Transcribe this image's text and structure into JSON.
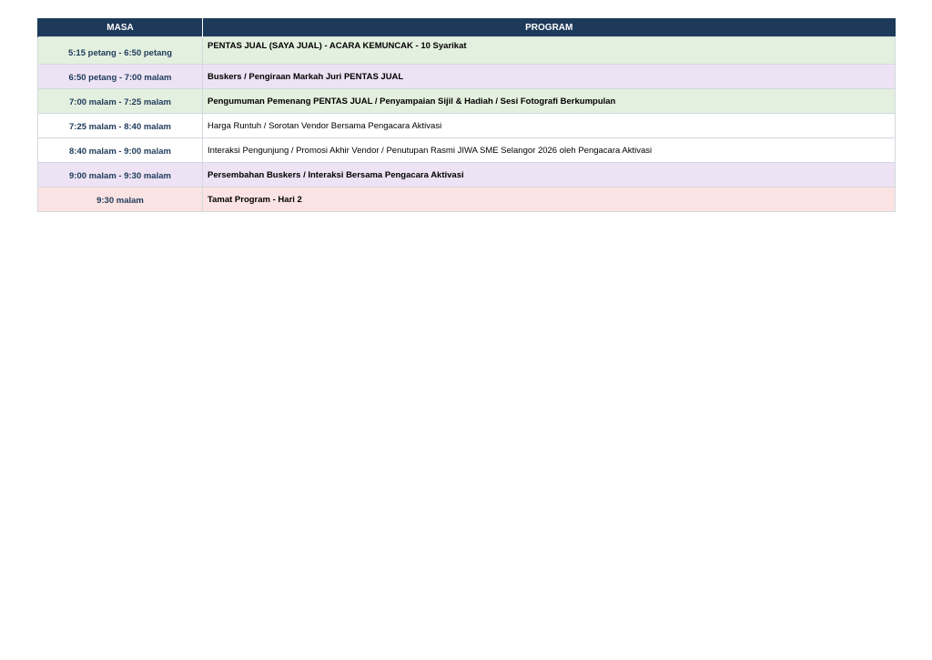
{
  "table": {
    "headers": {
      "masa": "MASA",
      "program": "PROGRAM"
    },
    "rows": [
      {
        "masa": "5:15 petang - 6:50 petang",
        "program": "PENTAS JUAL (SAYA JUAL) - ACARA KEMUNCAK - 10 Syarikat",
        "color": "#e4f0df",
        "bold": true
      },
      {
        "masa": "6:50 petang - 7:00 malam",
        "program": "Buskers / Pengiraan Markah Juri PENTAS JUAL",
        "color": "#ede3f4",
        "bold": true
      },
      {
        "masa": "7:00 malam - 7:25 malam",
        "program": "Pengumuman Pemenang PENTAS JUAL / Penyampaian Sijil & Hadiah / Sesi Fotografi Berkumpulan",
        "color": "#e4f0df",
        "bold": true
      },
      {
        "masa": "7:25 malam - 8:40 malam",
        "program": "Harga Runtuh / Sorotan Vendor Bersama Pengacara Aktivasi",
        "color": "#ffffff",
        "bold": false
      },
      {
        "masa": "8:40 malam - 9:00 malam",
        "program": "Interaksi Pengunjung / Promosi Akhir Vendor / Penutupan Rasmi JIWA SME Selangor 2026 oleh Pengacara Aktivasi",
        "color": "#ffffff",
        "bold": false
      },
      {
        "masa": "9:00 malam - 9:30 malam",
        "program": "Persembahan Buskers / Interaksi Bersama Pengacara Aktivasi",
        "color": "#ede3f4",
        "bold": true
      },
      {
        "masa": "9:30 malam",
        "program": "Tamat Program - Hari 2",
        "color": "#fbe3e3",
        "bold": true
      }
    ]
  },
  "colors": {
    "header_bg": "#1e3a5a",
    "masa_text": "#1e3a5a",
    "border": "#d3d8de"
  }
}
